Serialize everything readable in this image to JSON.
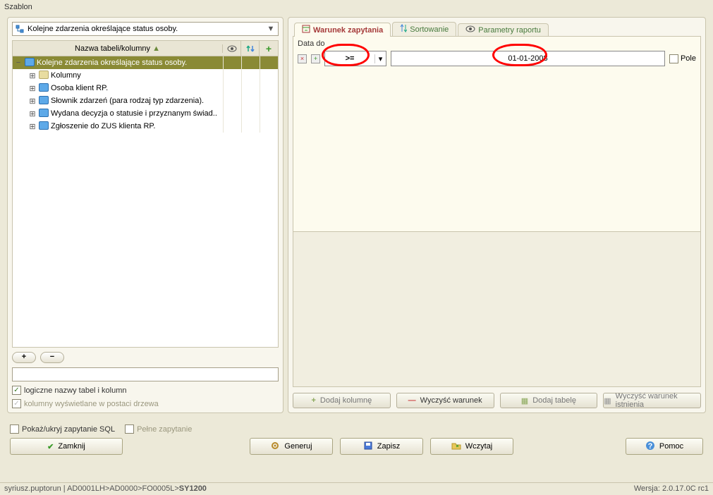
{
  "window_title": "Szablon",
  "left": {
    "combo_label": "Kolejne zdarzenia określające status osoby.",
    "header": "Nazwa tabeli/kolumny",
    "tree": [
      {
        "label": "Kolejne zdarzenia określające status osoby.",
        "selected": true,
        "expanded": true,
        "level": 0
      },
      {
        "label": "Kolumny",
        "level": 1
      },
      {
        "label": "Osoba klient RP.",
        "level": 1
      },
      {
        "label": "Słownik zdarzeń (para rodzaj typ zdarzenia).",
        "level": 1
      },
      {
        "label": "Wydana decyzja o statusie i przyznanym świad..",
        "level": 1
      },
      {
        "label": "Zgłoszenie do ZUS klienta RP.",
        "level": 1
      }
    ],
    "checkbox1": "logiczne nazwy tabel i kolumn",
    "checkbox2": "kolumny wyświetlane w postaci drzewa"
  },
  "right": {
    "tab1": "Warunek zapytania",
    "tab2": "Sortowanie",
    "tab3": "Parametry raportu",
    "field_label": "Data do",
    "operator": ">=",
    "value": "01-01-2008",
    "pole": "Pole",
    "btn_add_col": "Dodaj kolumnę",
    "btn_clear_cond": "Wyczyść warunek",
    "btn_add_table": "Dodaj tabelę",
    "btn_clear_exist": "Wyczyść warunek istnienia"
  },
  "bottom": {
    "show_sql": "Pokaż/ukryj zapytanie SQL",
    "full_query": "Pełne zapytanie",
    "close": "Zamknij",
    "generate": "Generuj",
    "save": "Zapisz",
    "load": "Wczytaj",
    "help": "Pomoc"
  },
  "status_left": "syriusz.puptorun | AD0001LH>AD0000>FO0005L>",
  "status_left_bold": "SY1200",
  "status_right": "Wersja: 2.0.17.0C  rc1"
}
